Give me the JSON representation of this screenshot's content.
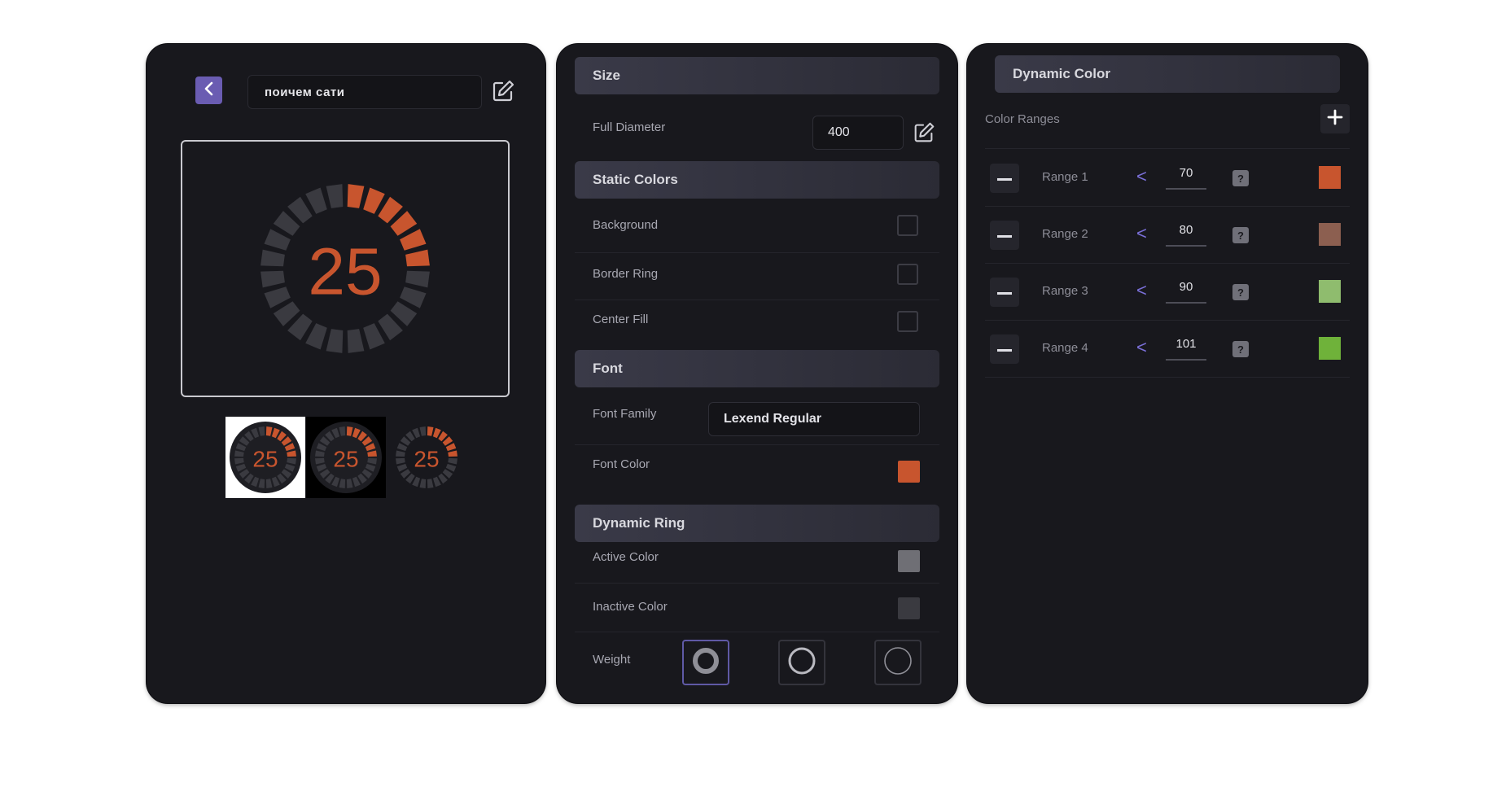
{
  "editor": {
    "name_value": "поичем сати"
  },
  "gauge": {
    "value": "25",
    "active_fraction": 0.25,
    "segments": 24,
    "active_color": "#c8552e",
    "inactive_color": "#3a3a40",
    "variants": [
      {
        "value": "25",
        "background": "#ffffff"
      },
      {
        "value": "25",
        "background": "#000000"
      },
      {
        "value": "25",
        "background": "#18181d"
      }
    ]
  },
  "size_section": {
    "title": "Size",
    "full_diameter_label": "Full Diameter",
    "full_diameter_value": "400"
  },
  "static_colors": {
    "title": "Static Colors",
    "rows": [
      {
        "label": "Background"
      },
      {
        "label": "Border Ring"
      },
      {
        "label": "Center Fill"
      }
    ]
  },
  "font_section": {
    "title": "Font",
    "family_label": "Font Family",
    "family_value": "Lexend Regular",
    "color_label": "Font Color",
    "color_value": "#c8552e"
  },
  "dynamic_ring": {
    "title": "Dynamic Ring",
    "active_label": "Active Color",
    "active_color": "#6f6f75",
    "inactive_label": "Inactive Color",
    "inactive_color": "#3a3a40",
    "weight_label": "Weight"
  },
  "dynamic_color": {
    "title": "Dynamic Color",
    "ranges_label": "Color Ranges",
    "comparator": "<",
    "help": "?",
    "ranges": [
      {
        "label": "Range 1",
        "value": "70",
        "color": "#c8552e"
      },
      {
        "label": "Range 2",
        "value": "80",
        "color": "#8c5f50"
      },
      {
        "label": "Range 3",
        "value": "90",
        "color": "#8fbc6e"
      },
      {
        "label": "Range 4",
        "value": "101",
        "color": "#6fb23a"
      }
    ]
  }
}
